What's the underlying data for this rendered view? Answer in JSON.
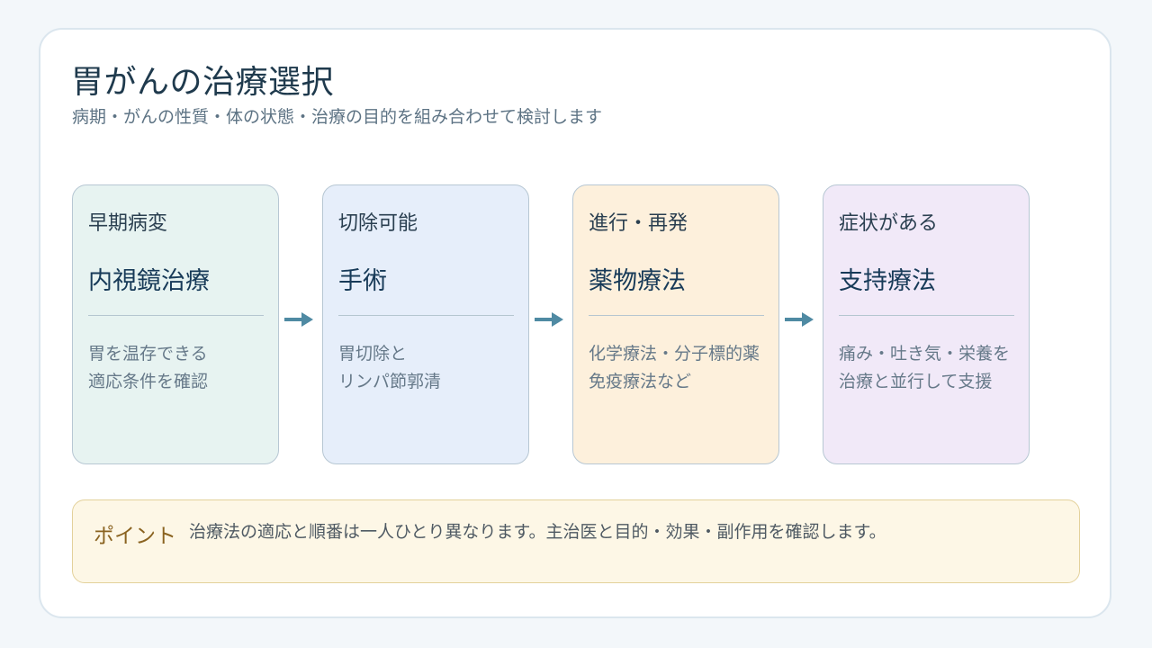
{
  "title": "胃がんの治療選択",
  "subtitle": "病期・がんの性質・体の状態・治療の目的を組み合わせて検討します",
  "steps": [
    {
      "stage": "早期病変",
      "treatment": "内視鏡治療",
      "desc_line1": "胃を温存できる",
      "desc_line2": "適応条件を確認",
      "color": "#e7f3f1"
    },
    {
      "stage": "切除可能",
      "treatment": "手術",
      "desc_line1": "胃切除と",
      "desc_line2": "リンパ節郭清",
      "color": "#e6eefa"
    },
    {
      "stage": "進行・再発",
      "treatment": "薬物療法",
      "desc_line1": "化学療法・分子標的薬",
      "desc_line2": "免疫療法など",
      "color": "#fdf0dc"
    },
    {
      "stage": "症状がある",
      "treatment": "支持療法",
      "desc_line1": "痛み・吐き気・栄養を",
      "desc_line2": "治療と並行して支援",
      "color": "#f1e9f8"
    }
  ],
  "note": {
    "label": "ポイント",
    "text": "治療法の適応と順番は一人ひとり異なります。主治医と目的・効果・副作用を確認します。"
  },
  "colors": {
    "arrow": "#4f8aa3",
    "border": "#b7c7d3",
    "note_bg": "#fdf7e6",
    "note_border": "#e3d19b"
  },
  "icons": [
    "arrow-right-icon"
  ]
}
